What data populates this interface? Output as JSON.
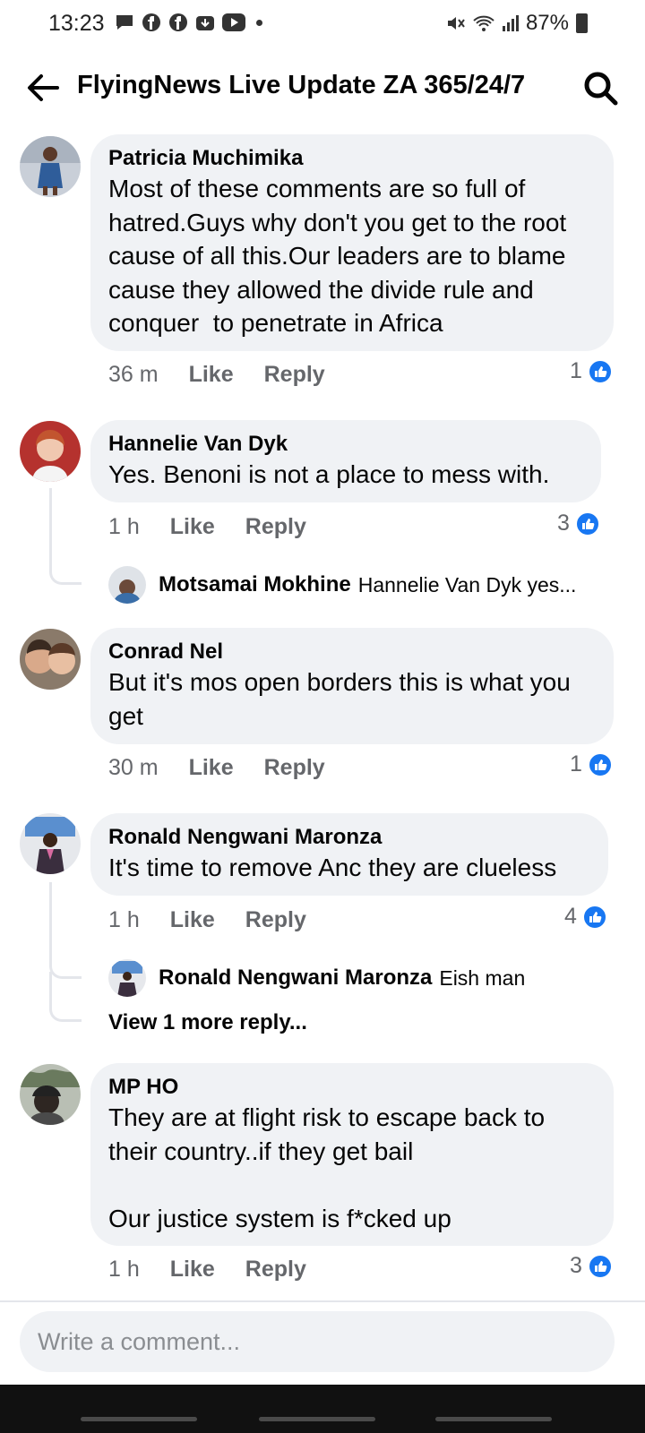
{
  "status_bar": {
    "time": "13:23",
    "battery": "87%",
    "left_icons": [
      "message-icon",
      "facebook-icon",
      "facebook-icon",
      "download-icon",
      "youtube-icon",
      "dot-icon"
    ],
    "right_icons": [
      "mute-icon",
      "wifi-icon",
      "signal-icon",
      "battery-icon"
    ]
  },
  "header": {
    "title": "FlyingNews Live Update ZA 365/24/7"
  },
  "colors": {
    "bubble": "#f0f2f5",
    "like_blue": "#1877f2",
    "secondary_text": "#65676b"
  },
  "comments": [
    {
      "author": "Patricia Muchimika",
      "text": "Most of these comments are so full of hatred.Guys why don't you get to the root cause of all this.Our leaders are to blame cause they allowed the divide rule and conquer  to penetrate in Africa",
      "time": "36 m",
      "like_label": "Like",
      "reply_label": "Reply",
      "likes": "1"
    },
    {
      "author": "Hannelie Van Dyk",
      "text": "Yes. Benoni is not a place to mess with.",
      "time": "1 h",
      "like_label": "Like",
      "reply_label": "Reply",
      "likes": "3",
      "reply": {
        "author": "Motsamai Mokhine",
        "snippet": "Hannelie Van Dyk yes..."
      }
    },
    {
      "author": "Conrad Nel",
      "text": "But it's mos open borders this is what you get",
      "time": "30 m",
      "like_label": "Like",
      "reply_label": "Reply",
      "likes": "1"
    },
    {
      "author": "Ronald Nengwani Maronza",
      "text": "It's time to remove Anc they are clueless",
      "time": "1 h",
      "like_label": "Like",
      "reply_label": "Reply",
      "likes": "4",
      "reply": {
        "author": "Ronald Nengwani Maronza",
        "snippet": "Eish man"
      },
      "view_more": "View 1 more reply..."
    },
    {
      "author": "MP HO",
      "text": "They are at flight risk to escape back to their country..if they get bail\n\nOur justice system is f*cked up",
      "time": "1 h",
      "like_label": "Like",
      "reply_label": "Reply",
      "likes": "3"
    }
  ],
  "composer": {
    "placeholder": "Write a comment..."
  }
}
